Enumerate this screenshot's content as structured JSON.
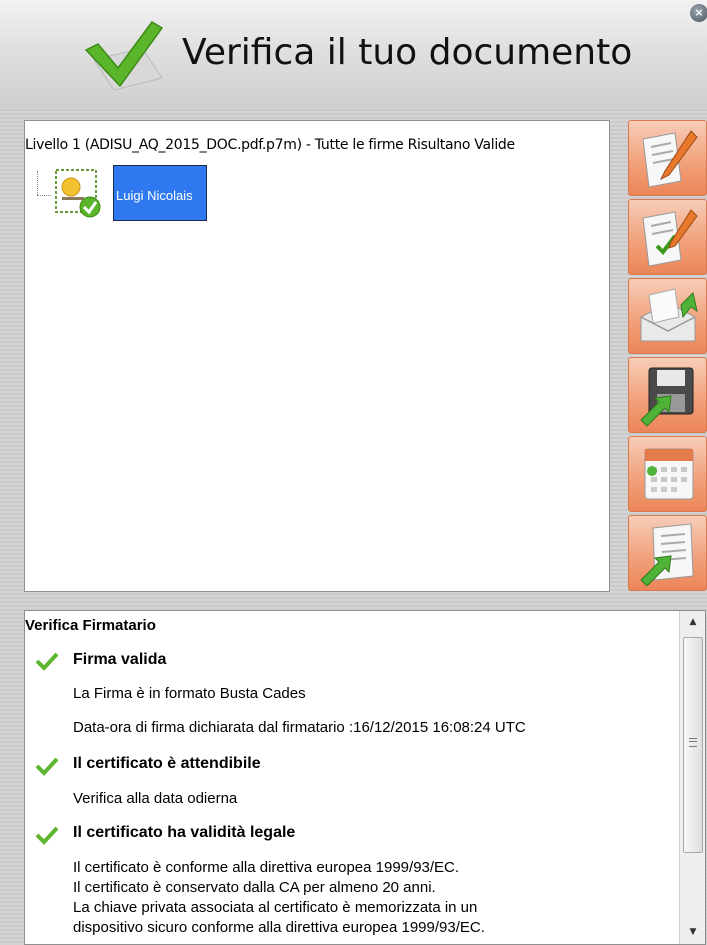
{
  "header": {
    "title": "Verifica il tuo documento",
    "logo_icon": "green-checkmark-icon",
    "close_icon": "close-icon",
    "close_symbol": "×"
  },
  "tree": {
    "root_label": "Livello 1 (ADISU_AQ_2015_DOC.pdf.p7m) - Tutte le firme Risultano Valide",
    "child": {
      "label": "Luigi Nicolais",
      "icon": "valid-certificate-icon",
      "selected": true
    }
  },
  "toolbar": {
    "buttons": [
      {
        "icon": "sign-document-icon"
      },
      {
        "icon": "verify-signature-icon"
      },
      {
        "icon": "open-envelope-icon"
      },
      {
        "icon": "save-disk-icon"
      },
      {
        "icon": "calendar-icon"
      },
      {
        "icon": "export-document-icon"
      }
    ]
  },
  "details": {
    "heading": "Verifica Firmatario",
    "sections": [
      {
        "title": "Firma valida",
        "lines": [
          "La Firma è in formato Busta Cades",
          "Data-ora di firma dichiarata dal firmatario :16/12/2015 16:08:24 UTC"
        ]
      },
      {
        "title": "Il certificato è attendibile",
        "lines": [
          "Verifica alla data odierna"
        ]
      },
      {
        "title": "Il certificato ha validità legale",
        "lines": [
          "Il certificato è conforme alla direttiva europea 1999/93/EC.",
          "Il certificato è conservato dalla CA per almeno 20 anni.",
          "La chiave privata associata al certificato è memorizzata in un",
          "dispositivo sicuro conforme alla direttiva europea 1999/93/EC."
        ]
      }
    ]
  },
  "colors": {
    "selection": "#2f79f0",
    "check_green": "#5fb52f",
    "toolbar_orange": "#f1a27c"
  }
}
